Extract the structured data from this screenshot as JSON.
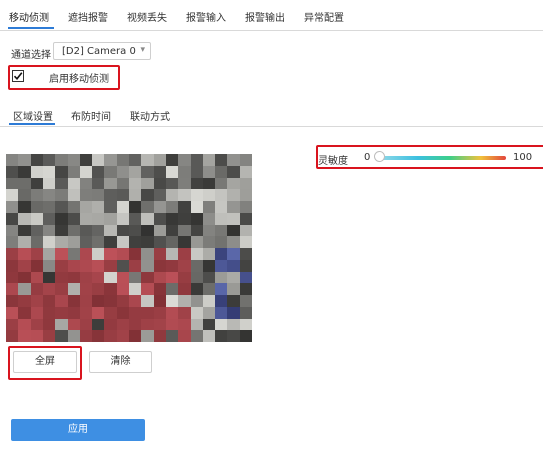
{
  "top_tabs": [
    {
      "label": "移动侦测",
      "active": true
    },
    {
      "label": "遮挡报警",
      "active": false
    },
    {
      "label": "视频丢失",
      "active": false
    },
    {
      "label": "报警输入",
      "active": false
    },
    {
      "label": "报警输出",
      "active": false
    },
    {
      "label": "异常配置",
      "active": false
    }
  ],
  "channel": {
    "label": "通道选择",
    "value": "[D2] Camera 0"
  },
  "enable_motion": {
    "label": "启用移动侦测",
    "checked": true
  },
  "sub_tabs": [
    {
      "label": "区域设置",
      "active": true
    },
    {
      "label": "布防时间",
      "active": false
    },
    {
      "label": "联动方式",
      "active": false
    }
  ],
  "sensitivity": {
    "label": "灵敏度",
    "min": "0",
    "max": "100",
    "value": 0
  },
  "buttons": {
    "fullscreen": "全屏",
    "clear": "清除",
    "apply": "应用"
  },
  "colors": {
    "accent": "#2d7bd6",
    "primary_button": "#3e8fe3",
    "highlight": "#d9141e"
  }
}
